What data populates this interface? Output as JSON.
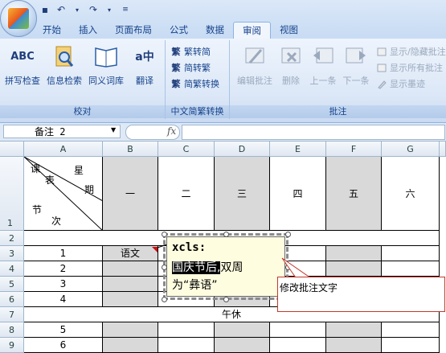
{
  "quick_access": {
    "save_icon": "save-icon",
    "undo_icon": "undo-icon",
    "redo_icon": "redo-icon",
    "customize_icon": "customize-icon"
  },
  "tabs": [
    "开始",
    "插入",
    "页面布局",
    "公式",
    "数据",
    "审阅",
    "视图"
  ],
  "active_tab": "审阅",
  "ribbon": {
    "proofing": {
      "label": "校对",
      "buttons": [
        "拼写检查",
        "信息检索",
        "同义词库",
        "翻译"
      ],
      "icons": [
        "ABC",
        "",
        "",
        "a中"
      ]
    },
    "chinese_conversion": {
      "label": "中文简繁转换",
      "buttons": [
        "繁转简",
        "简转繁",
        "简繁转换"
      ]
    },
    "comments": {
      "label": "批注",
      "buttons": [
        "编辑批注",
        "删除",
        "上一条",
        "下一条"
      ],
      "right_buttons": [
        "显示/隐藏批注",
        "显示所有批注",
        "显示墨迹"
      ]
    }
  },
  "formula_bar": {
    "name_box": "备注 2",
    "fx": "fx"
  },
  "columns": [
    "A",
    "B",
    "C",
    "D",
    "E",
    "F",
    "G"
  ],
  "rows": [
    "1",
    "2",
    "3",
    "4",
    "5",
    "6",
    "7",
    "8",
    "9"
  ],
  "header_cell": {
    "ke": "课",
    "biao": "表",
    "xing": "星",
    "qi": "期",
    "jie": "节",
    "ci": "次"
  },
  "weekdays": [
    "一",
    "二",
    "三",
    "四",
    "五",
    "六"
  ],
  "periods": [
    "1",
    "2",
    "3",
    "4",
    "5",
    "6"
  ],
  "subject_b3": "语文",
  "lunch": "午休",
  "comment": {
    "author": "xcls:",
    "line1_selected": "国庆节后,",
    "line1_rest": "双周",
    "line2": "为“彝语”"
  },
  "callout": "修改批注文字"
}
